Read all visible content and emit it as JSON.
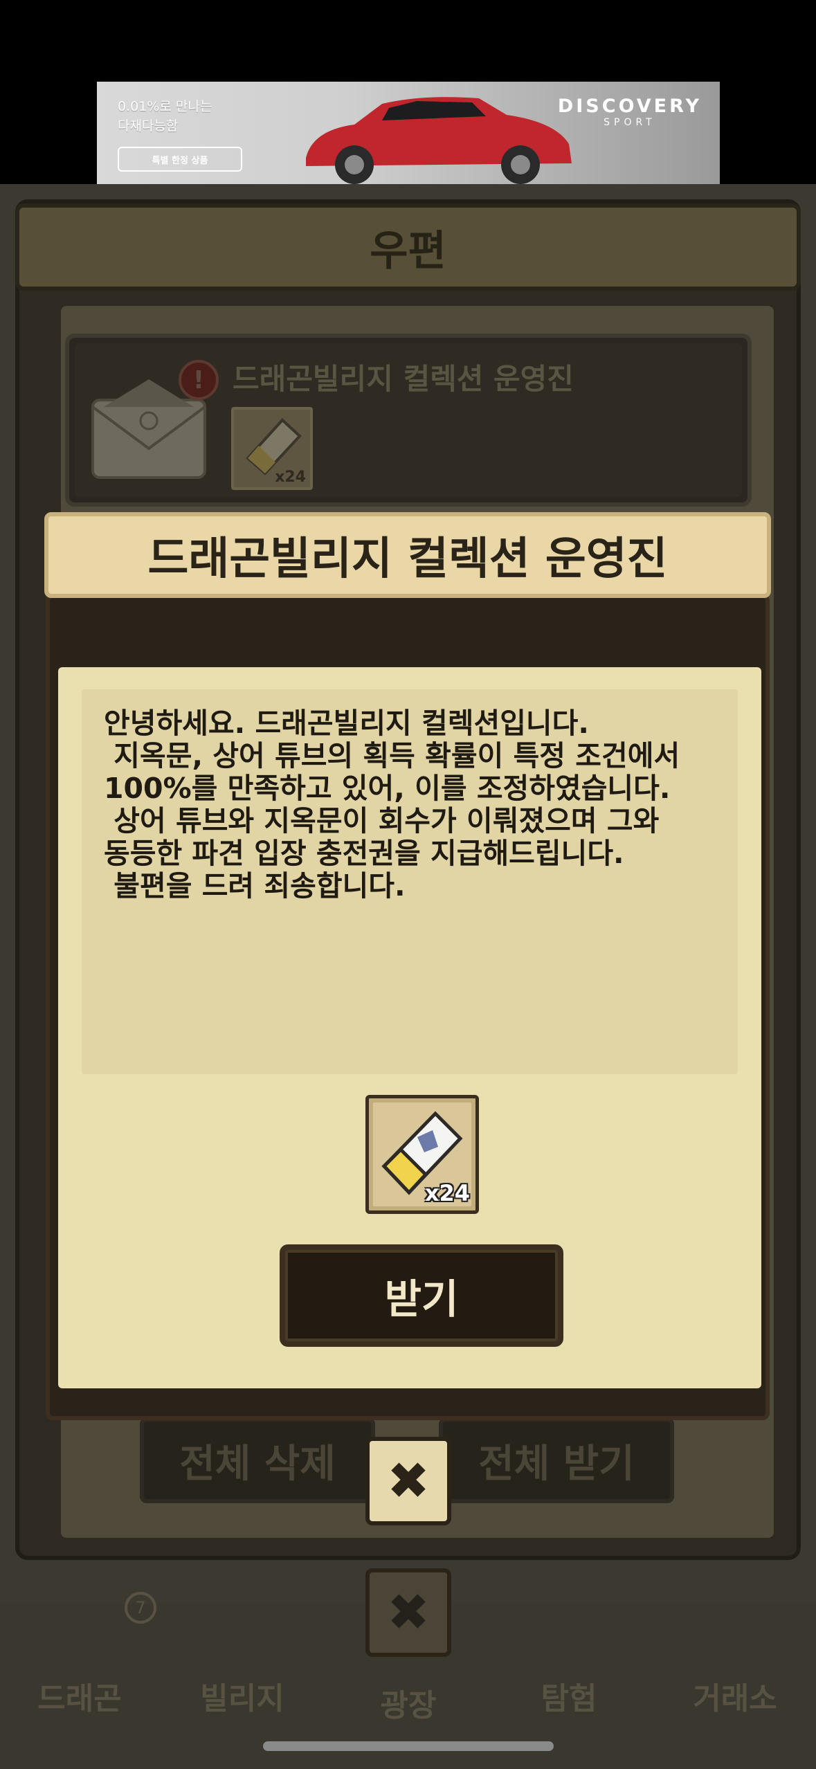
{
  "ad": {
    "line1": "0.01%로 만나는",
    "line2": "다재다능함",
    "button": "특별 한정 상품",
    "brand": "DISCOVERY",
    "sub": "SPORT"
  },
  "mail": {
    "title": "우편",
    "item_title": "드래곤빌리지 컬렉션 운영진",
    "item_reward_qty": "x24",
    "alert": "!"
  },
  "background_actions": {
    "delete_all": "전체 삭제",
    "receive_all": "전체 받기"
  },
  "bottom_nav": {
    "items": [
      "드래곤",
      "빌리지",
      "광장",
      "탐험",
      "거래소"
    ],
    "badge": "7"
  },
  "dialog": {
    "title": "드래곤빌리지 컬렉션 운영진",
    "message": "안녕하세요. 드래곤빌리지 컬렉션입니다.\n 지옥문, 상어 튜브의 획득 확률이 특정 조건에서\n100%를 만족하고 있어, 이를 조정하였습니다.\n 상어 튜브와 지옥문이 회수가 이뤄졌으며 그와\n동등한 파견 입장 충전권을 지급해드립니다.\n 불편을 드려 죄송합니다.",
    "reward_qty": "x24",
    "receive_label": "받기"
  },
  "icons": {
    "close": "close-icon",
    "ticket": "ticket-icon",
    "envelope": "envelope-icon"
  }
}
